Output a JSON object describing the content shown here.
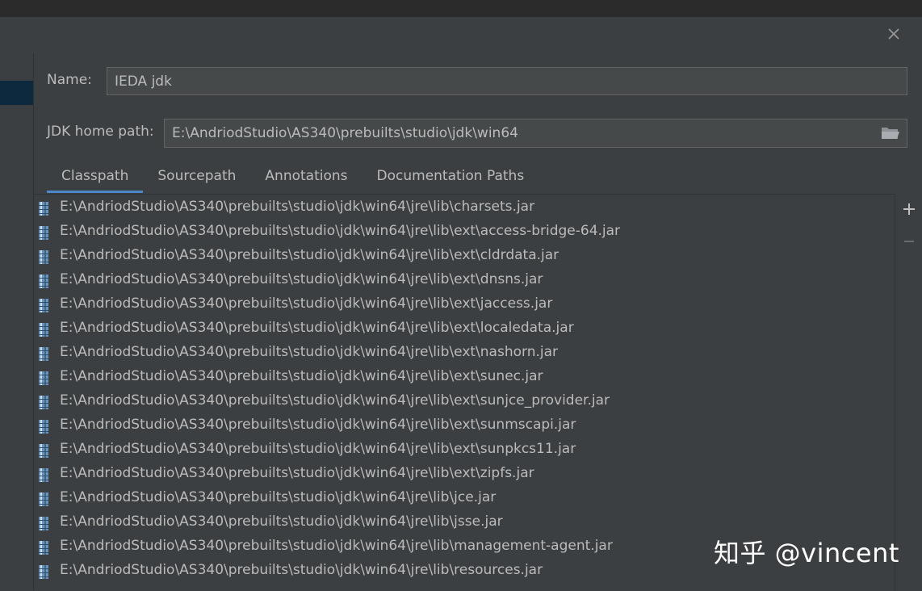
{
  "dialog": {
    "name_label": "Name:",
    "name_value": "IEDA jdk",
    "home_path_label": "JDK home path:",
    "home_path_value": "E:\\AndriodStudio\\AS340\\prebuilts\\studio\\jdk\\win64"
  },
  "tabs": [
    {
      "label": "Classpath",
      "active": true
    },
    {
      "label": "Sourcepath",
      "active": false
    },
    {
      "label": "Annotations",
      "active": false
    },
    {
      "label": "Documentation Paths",
      "active": false
    }
  ],
  "classpath": [
    "E:\\AndriodStudio\\AS340\\prebuilts\\studio\\jdk\\win64\\jre\\lib\\charsets.jar",
    "E:\\AndriodStudio\\AS340\\prebuilts\\studio\\jdk\\win64\\jre\\lib\\ext\\access-bridge-64.jar",
    "E:\\AndriodStudio\\AS340\\prebuilts\\studio\\jdk\\win64\\jre\\lib\\ext\\cldrdata.jar",
    "E:\\AndriodStudio\\AS340\\prebuilts\\studio\\jdk\\win64\\jre\\lib\\ext\\dnsns.jar",
    "E:\\AndriodStudio\\AS340\\prebuilts\\studio\\jdk\\win64\\jre\\lib\\ext\\jaccess.jar",
    "E:\\AndriodStudio\\AS340\\prebuilts\\studio\\jdk\\win64\\jre\\lib\\ext\\localedata.jar",
    "E:\\AndriodStudio\\AS340\\prebuilts\\studio\\jdk\\win64\\jre\\lib\\ext\\nashorn.jar",
    "E:\\AndriodStudio\\AS340\\prebuilts\\studio\\jdk\\win64\\jre\\lib\\ext\\sunec.jar",
    "E:\\AndriodStudio\\AS340\\prebuilts\\studio\\jdk\\win64\\jre\\lib\\ext\\sunjce_provider.jar",
    "E:\\AndriodStudio\\AS340\\prebuilts\\studio\\jdk\\win64\\jre\\lib\\ext\\sunmscapi.jar",
    "E:\\AndriodStudio\\AS340\\prebuilts\\studio\\jdk\\win64\\jre\\lib\\ext\\sunpkcs11.jar",
    "E:\\AndriodStudio\\AS340\\prebuilts\\studio\\jdk\\win64\\jre\\lib\\ext\\zipfs.jar",
    "E:\\AndriodStudio\\AS340\\prebuilts\\studio\\jdk\\win64\\jre\\lib\\jce.jar",
    "E:\\AndriodStudio\\AS340\\prebuilts\\studio\\jdk\\win64\\jre\\lib\\jsse.jar",
    "E:\\AndriodStudio\\AS340\\prebuilts\\studio\\jdk\\win64\\jre\\lib\\management-agent.jar",
    "E:\\AndriodStudio\\AS340\\prebuilts\\studio\\jdk\\win64\\jre\\lib\\resources.jar"
  ],
  "tools": {
    "add_icon": "plus-icon",
    "remove_icon": "minus-icon"
  },
  "watermark": "知乎 @vincent",
  "colors": {
    "background": "#3c3f41",
    "field_background": "#45494a",
    "text": "#bbbbbb",
    "tab_underline": "#4a88c7",
    "selection": "#0d293e"
  }
}
